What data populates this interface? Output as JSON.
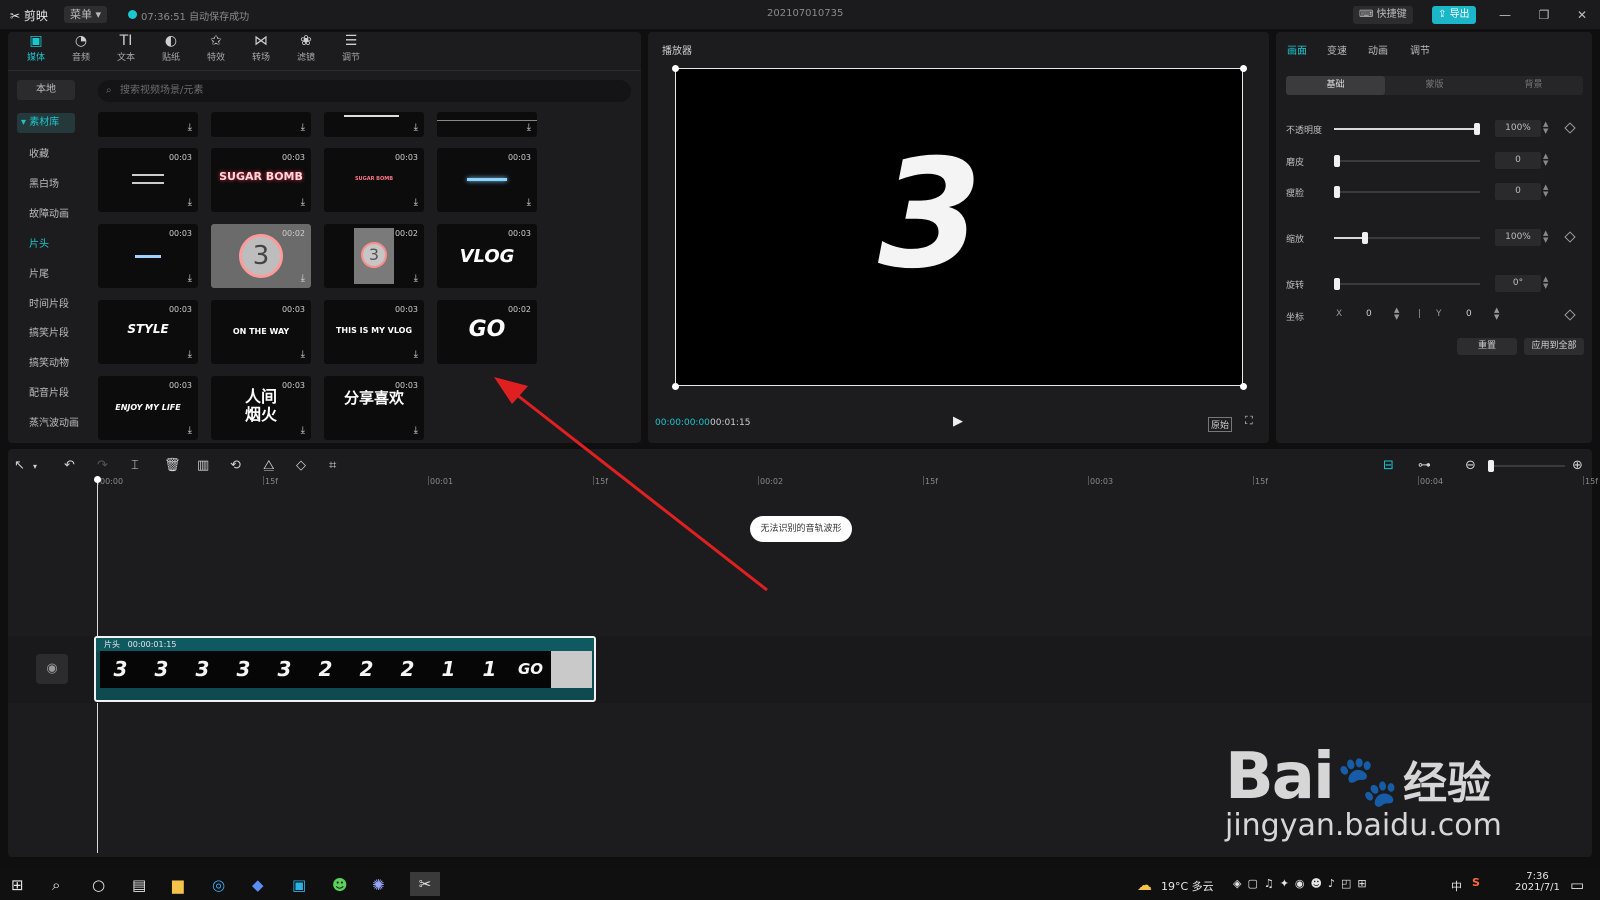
{
  "titlebar": {
    "app_name": "剪映",
    "menu_label": "菜单",
    "save_status": "07:36:51 自动保存成功",
    "project_name": "202107010735",
    "shortcut_label": "快捷键",
    "export_label": "导出"
  },
  "media_tools": [
    {
      "label": "媒体",
      "icon": "media-icon"
    },
    {
      "label": "音频",
      "icon": "audio-icon"
    },
    {
      "label": "文本",
      "icon": "text-icon"
    },
    {
      "label": "贴纸",
      "icon": "sticker-icon"
    },
    {
      "label": "特效",
      "icon": "effects-icon"
    },
    {
      "label": "转场",
      "icon": "transition-icon"
    },
    {
      "label": "滤镜",
      "icon": "filter-icon"
    },
    {
      "label": "调节",
      "icon": "adjust-icon"
    }
  ],
  "categories": {
    "local": "本地",
    "library": "素材库",
    "items": [
      "收藏",
      "黑白场",
      "故障动画",
      "片头",
      "片尾",
      "时间片段",
      "搞笑片段",
      "搞笑动物",
      "配音片段",
      "蒸汽波动画"
    ],
    "selected": "片头"
  },
  "search": {
    "placeholder": "搜索视频场景/元素"
  },
  "tiles": [
    {
      "caption": "",
      "duration": ""
    },
    {
      "caption": "",
      "duration": ""
    },
    {
      "caption": "",
      "duration": ""
    },
    {
      "caption": "",
      "duration": ""
    },
    {
      "caption": "",
      "duration": "00:03"
    },
    {
      "caption": "SUGAR BOMB",
      "duration": "00:03"
    },
    {
      "caption": "SUGAR BOMB",
      "duration": "00:03"
    },
    {
      "caption": "",
      "duration": "00:03"
    },
    {
      "caption": "",
      "duration": "00:03"
    },
    {
      "caption": "3",
      "duration": "00:02"
    },
    {
      "caption": "3",
      "duration": "00:02"
    },
    {
      "caption": "VLOG",
      "duration": "00:03"
    },
    {
      "caption": "STYLE",
      "duration": "00:03"
    },
    {
      "caption": "ON THE WAY",
      "duration": "00:03"
    },
    {
      "caption": "THIS IS MY VLOG",
      "duration": "00:03"
    },
    {
      "caption": "GO",
      "duration": "00:02"
    },
    {
      "caption": "ENJOY MY LIFE",
      "duration": "00:03"
    },
    {
      "caption": "人间烟火",
      "duration": "00:03"
    },
    {
      "caption": "分享喜欢",
      "duration": "00:03"
    }
  ],
  "player": {
    "title": "播放器",
    "display_number": "3",
    "current_time": "00:00:00:00",
    "total_time": "00:01:15",
    "original_label": "原始"
  },
  "inspector": {
    "tabs": [
      "画面",
      "变速",
      "动画",
      "调节"
    ],
    "selected_tab": "画面",
    "segments": [
      "基础",
      "蒙版",
      "背景"
    ],
    "properties": [
      {
        "label": "不透明度",
        "value": "100%",
        "level": 1.0
      },
      {
        "label": "磨皮",
        "value": "0",
        "level": 0.0
      },
      {
        "label": "瘦脸",
        "value": "0",
        "level": 0.0
      },
      {
        "label": "缩放",
        "value": "100%",
        "level": 0.2
      },
      {
        "label": "旋转",
        "value": "0°",
        "level": 0.0
      }
    ],
    "position": {
      "label": "坐标",
      "x_label": "X",
      "x_value": "0",
      "y_label": "Y",
      "y_value": "0"
    },
    "reset_label": "重置",
    "apply_all_label": "应用到全部"
  },
  "timeline": {
    "ruler": [
      "00:00",
      "15f",
      "00:01",
      "15f",
      "00:02",
      "15f",
      "00:03",
      "15f",
      "00:04",
      "15f"
    ],
    "waveform_notice": "无法识别的音轨波形",
    "clip": {
      "name": "片头",
      "duration": "00:00:01:15",
      "frames": [
        "3",
        "3",
        "3",
        "3",
        "3",
        "2",
        "2",
        "2",
        "1",
        "1",
        "GO",
        ""
      ]
    }
  },
  "taskbar": {
    "weather": "19°C 多云",
    "ime": "中",
    "time": "7:36",
    "date": "2021/7/1"
  },
  "watermark": {
    "brand": "Bai",
    "brand_suffix": "经验",
    "url": "jingyan.baidu.com"
  },
  "colors": {
    "accent": "#1bc6cf",
    "arrow": "#e02020",
    "clip_bg": "#0e4b50"
  }
}
